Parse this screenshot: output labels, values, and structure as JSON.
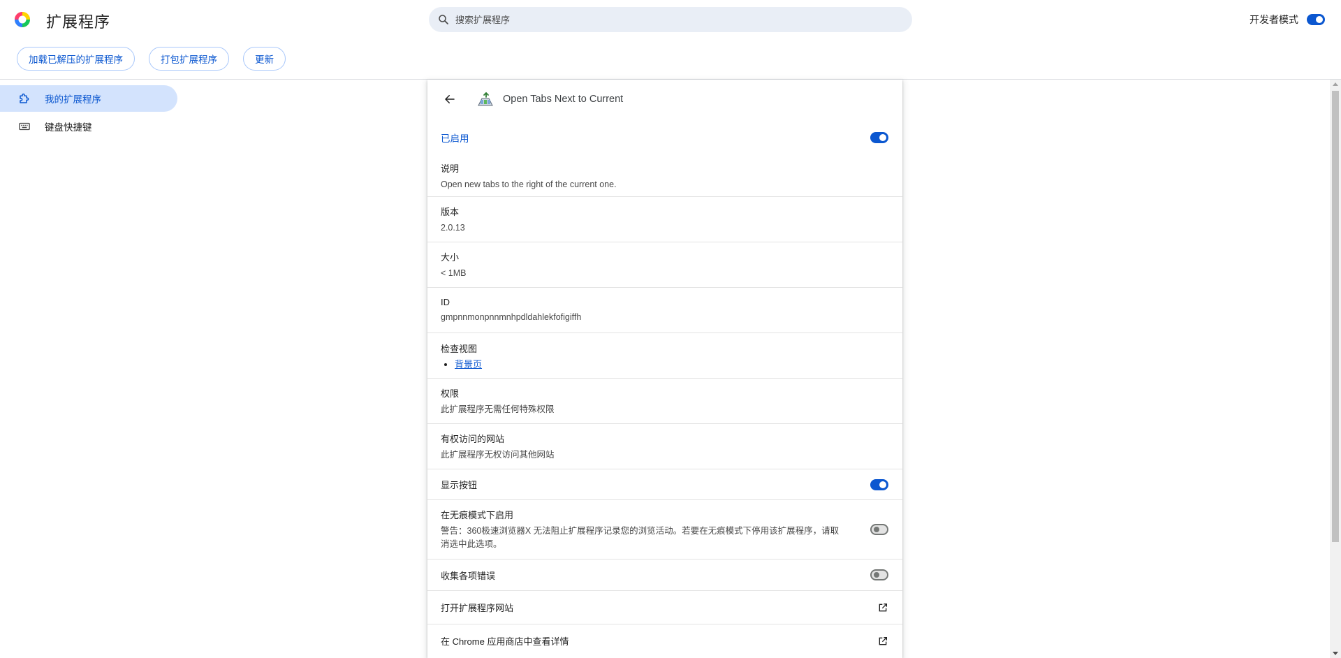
{
  "header": {
    "title": "扩展程序",
    "search_placeholder": "搜索扩展程序",
    "dev_mode_label": "开发者模式",
    "dev_mode_on": true
  },
  "toolbar": {
    "load_unpacked": "加载已解压的扩展程序",
    "pack": "打包扩展程序",
    "update": "更新"
  },
  "sidebar": {
    "items": [
      {
        "label": "我的扩展程序",
        "icon": "puzzle-icon",
        "active": true
      },
      {
        "label": "键盘快捷键",
        "icon": "keyboard-icon",
        "active": false
      }
    ]
  },
  "extension": {
    "name": "Open Tabs Next to Current",
    "icon": "extension-icon",
    "enabled_label": "已启用",
    "enabled": true,
    "description_title": "说明",
    "description": "Open new tabs to the right of the current one.",
    "version_title": "版本",
    "version": "2.0.13",
    "size_title": "大小",
    "size": "< 1MB",
    "id_title": "ID",
    "id": "gmpnnmonpnnmnhpdldahlekfofigiffh",
    "inspect_title": "检查视图",
    "inspect_link": "背景页",
    "permissions_title": "权限",
    "permissions": "此扩展程序无需任何特殊权限",
    "site_access_title": "有权访问的网站",
    "site_access": "此扩展程序无权访问其他网站",
    "show_button_label": "显示按钮",
    "show_button_on": true,
    "incognito_title": "在无痕模式下启用",
    "incognito_warning": "警告：360极速浏览器X 无法阻止扩展程序记录您的浏览活动。若要在无痕模式下停用该扩展程序，请取消选中此选项。",
    "incognito_on": false,
    "collect_errors_label": "收集各项错误",
    "collect_errors_on": false,
    "open_site_label": "打开扩展程序网站",
    "store_label": "在 Chrome 应用商店中查看详情"
  },
  "colors": {
    "accent": "#0b57d0",
    "active_bg": "#d3e3fd",
    "search_bg": "#e9eef6"
  }
}
